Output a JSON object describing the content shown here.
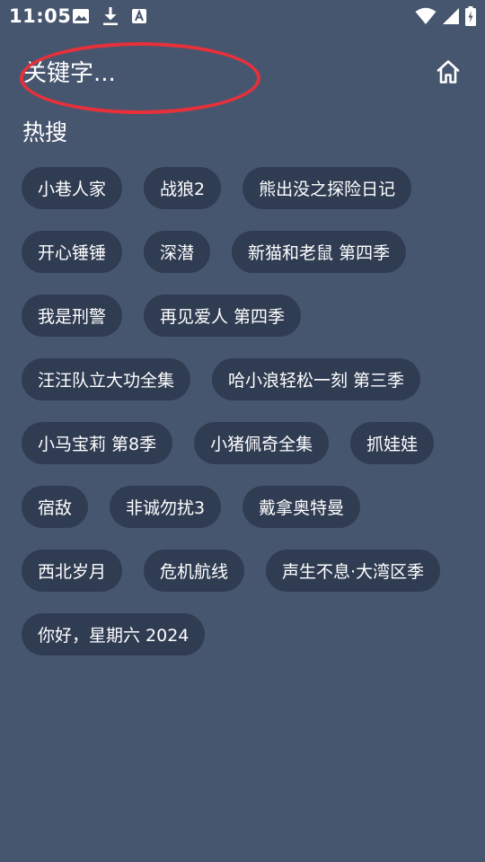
{
  "status_bar": {
    "time": "11:05",
    "left_icons": [
      "image-icon",
      "download-icon",
      "app-icon"
    ],
    "right_icons": [
      "wifi-icon",
      "signal-icon",
      "battery-icon"
    ]
  },
  "search": {
    "placeholder": "关键字..."
  },
  "annotation": {
    "shape": "ellipse",
    "color": "#e8303a"
  },
  "home": {
    "icon": "home-icon"
  },
  "hot_search": {
    "title": "热搜",
    "tags": [
      "小巷人家",
      "战狼2",
      "熊出没之探险日记",
      "开心锤锤",
      "深潜",
      "新猫和老鼠 第四季",
      "我是刑警",
      "再见爱人 第四季",
      "汪汪队立大功全集",
      "哈小浪轻松一刻 第三季",
      "小马宝莉 第8季",
      "小猪佩奇全集",
      "抓娃娃",
      "宿敌",
      "非诚勿扰3",
      "戴拿奥特曼",
      "西北岁月",
      "危机航线",
      "声生不息·大湾区季",
      "你好，星期六 2024"
    ]
  },
  "colors": {
    "background": "#47566f",
    "tag_background": "#2f3c52",
    "text": "#ffffff",
    "annotation": "#e8303a"
  }
}
